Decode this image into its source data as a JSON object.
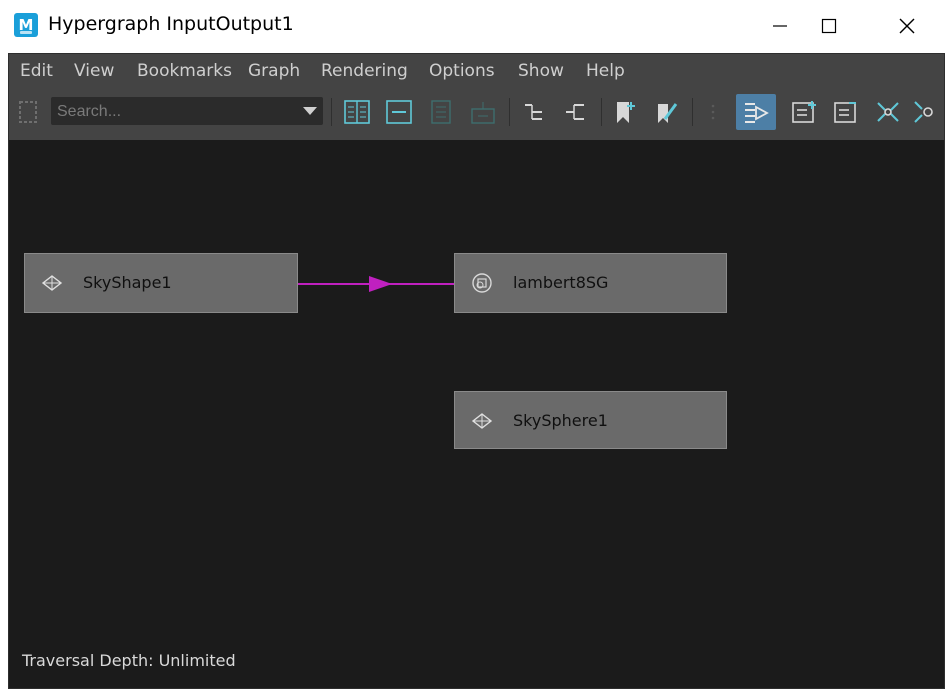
{
  "window": {
    "title": "Hypergraph  InputOutput1",
    "app_icon_letter": "M"
  },
  "menu": [
    "Edit",
    "View",
    "Bookmarks",
    "Graph",
    "Rendering",
    "Options",
    "Show",
    "Help"
  ],
  "toolbar": {
    "search_placeholder": "Search..."
  },
  "nodes": [
    {
      "label": "SkyShape1",
      "icon": "shape-node-icon"
    },
    {
      "label": "lambert8SG",
      "icon": "shading-group-icon"
    },
    {
      "label": "SkySphere1",
      "icon": "shape-node-icon"
    }
  ],
  "connection_color": "#c020c0",
  "status": {
    "traversal": "Traversal Depth: Unlimited"
  }
}
